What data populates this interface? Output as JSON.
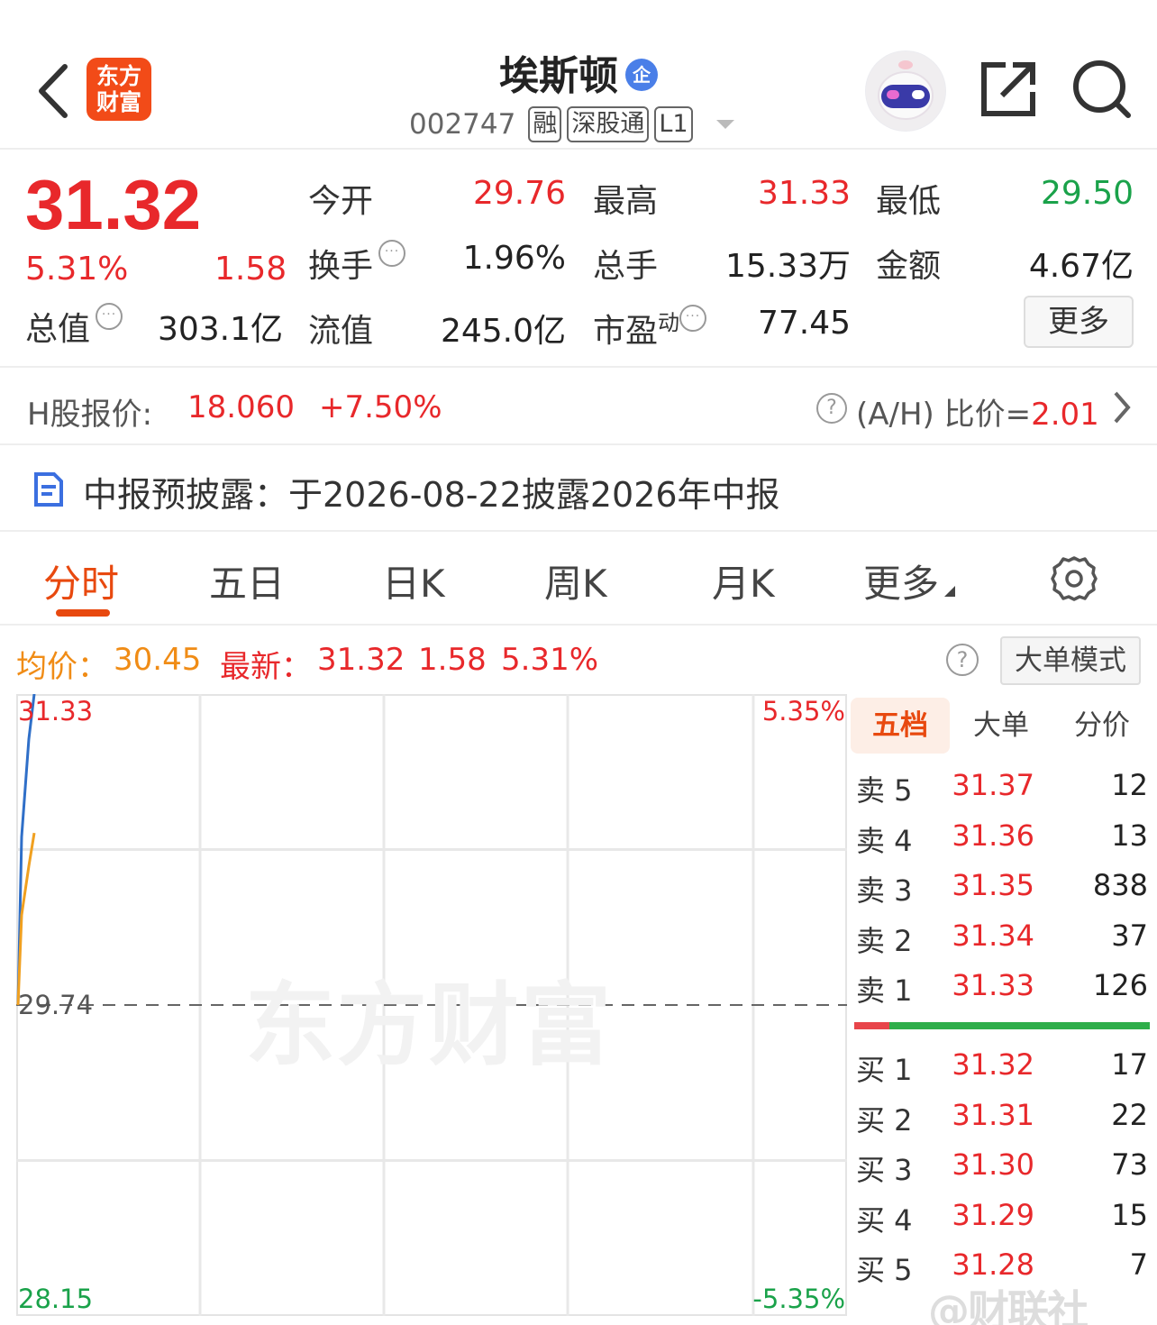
{
  "header": {
    "logo_line1": "东方",
    "logo_line2": "财富",
    "stock_name": "埃斯顿",
    "name_badge": "企",
    "stock_code": "002747",
    "tags": [
      "融",
      "深股通",
      "L1"
    ]
  },
  "quote": {
    "price": "31.32",
    "change_pct": "5.31%",
    "change": "1.58",
    "open_label": "今开",
    "open": "29.76",
    "high_label": "最高",
    "high": "31.33",
    "low_label": "最低",
    "low": "29.50",
    "turnover_label": "换手",
    "turnover": "1.96%",
    "volume_label": "总手",
    "volume": "15.33万",
    "amount_label": "金额",
    "amount": "4.67亿",
    "mktcap_label": "总值",
    "mktcap": "303.1亿",
    "float_label": "流值",
    "float": "245.0亿",
    "pe_label": "市盈",
    "pe_sup": "动",
    "pe": "77.45",
    "more_label": "更多"
  },
  "h_share": {
    "label": "H股报价:",
    "price": "18.060",
    "change_pct": "+7.50%",
    "ratio_label": "(A/H) 比价=",
    "ratio": "2.01"
  },
  "report": {
    "text": "中报预披露：于2026-08-22披露2026年中报"
  },
  "tabs": [
    "分时",
    "五日",
    "日K",
    "周K",
    "月K",
    "更多"
  ],
  "active_tab": "分时",
  "info": {
    "avg_label": "均价：",
    "avg": "30.45",
    "latest_label": "最新：",
    "latest": "31.32",
    "change": "1.58",
    "change_pct": "5.31%",
    "big_order_mode": "大单模式"
  },
  "chart_data": {
    "type": "line",
    "y_top": "31.33",
    "y_mid": "29.74",
    "y_bottom": "28.15",
    "pct_top": "5.35%",
    "pct_bottom": "-5.35%",
    "watermark": "东方财富",
    "ylim": [
      28.15,
      31.33
    ],
    "prev_close": 29.74,
    "series": [
      {
        "name": "price",
        "color": "#2f6fc8",
        "values": [
          29.74,
          30.6,
          31.1,
          31.33
        ]
      },
      {
        "name": "avg",
        "color": "#f0a020",
        "values": [
          29.74,
          30.2,
          30.45,
          30.62
        ]
      }
    ]
  },
  "order_book": {
    "tabs": [
      "五档",
      "大单",
      "分价"
    ],
    "asks": [
      {
        "label": "卖 5",
        "price": "31.37",
        "vol": "12"
      },
      {
        "label": "卖 4",
        "price": "31.36",
        "vol": "13"
      },
      {
        "label": "卖 3",
        "price": "31.35",
        "vol": "838"
      },
      {
        "label": "卖 2",
        "price": "31.34",
        "vol": "37"
      },
      {
        "label": "卖 1",
        "price": "31.33",
        "vol": "126"
      }
    ],
    "bids": [
      {
        "label": "买 1",
        "price": "31.32",
        "vol": "17"
      },
      {
        "label": "买 2",
        "price": "31.31",
        "vol": "22"
      },
      {
        "label": "买 3",
        "price": "31.30",
        "vol": "73"
      },
      {
        "label": "买 4",
        "price": "31.29",
        "vol": "15"
      },
      {
        "label": "买 5",
        "price": "31.28",
        "vol": "7"
      }
    ],
    "bid_ratio": 0.88
  },
  "corner_watermark": "@财联社"
}
